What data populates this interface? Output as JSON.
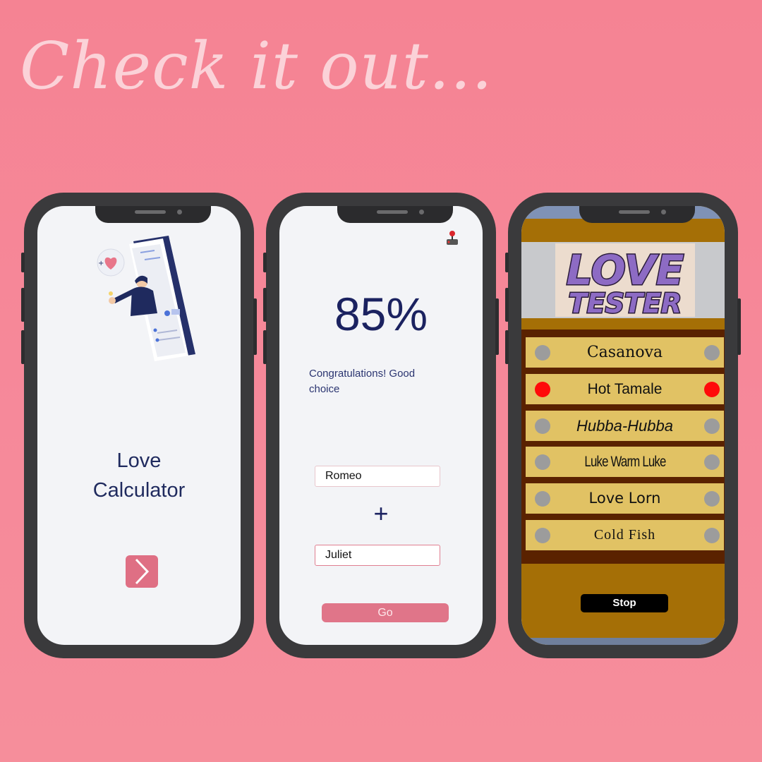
{
  "headline": "Check it out...",
  "colors": {
    "background": "#f6889a",
    "accent": "#df6f84",
    "navy": "#1b2260",
    "tester_wood": "#a56f06",
    "level_active": "#ff0a0a"
  },
  "phone1": {
    "title_line1": "Love",
    "title_line2": "Calculator",
    "next_icon": "chevron-right-icon"
  },
  "phone2": {
    "percent": "85%",
    "message": "Congratulations! Good choice",
    "name1": "Romeo",
    "plus": "+",
    "name2": "Juliet",
    "go_label": "Go",
    "corner_icon": "joystick-icon"
  },
  "phone3": {
    "logo_line1": "LOVE",
    "logo_line2": "TESTER",
    "levels": [
      {
        "label": "Casanova",
        "active": false
      },
      {
        "label": "Hot Tamale",
        "active": true
      },
      {
        "label": "Hubba-Hubba",
        "active": false
      },
      {
        "label": "Luke Warm Luke",
        "active": false
      },
      {
        "label": "Love Lorn",
        "active": false
      },
      {
        "label": "Cold Fish",
        "active": false
      }
    ],
    "stop_label": "Stop"
  }
}
